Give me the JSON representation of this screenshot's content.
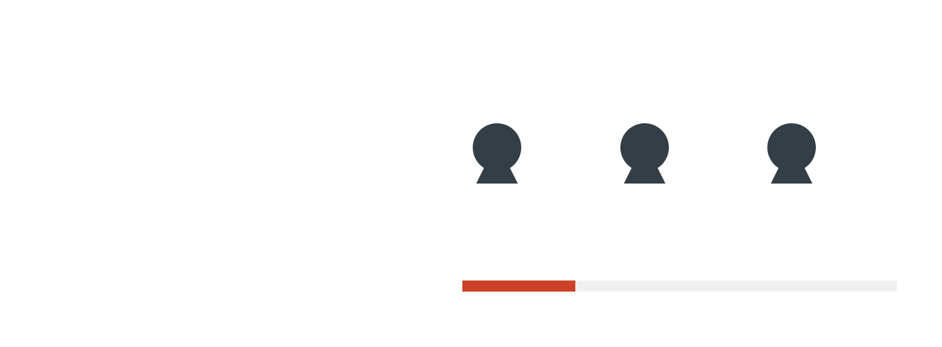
{
  "loader": {
    "icons": [
      {
        "icon": "user-icon"
      },
      {
        "icon": "user-icon"
      },
      {
        "icon": "user-icon"
      }
    ],
    "progress_fraction": 0.26
  },
  "colors": {
    "icon": "#333e46",
    "progress_fill": "#cc4128",
    "progress_track": "#f1f1f1",
    "background": "#ffffff"
  }
}
